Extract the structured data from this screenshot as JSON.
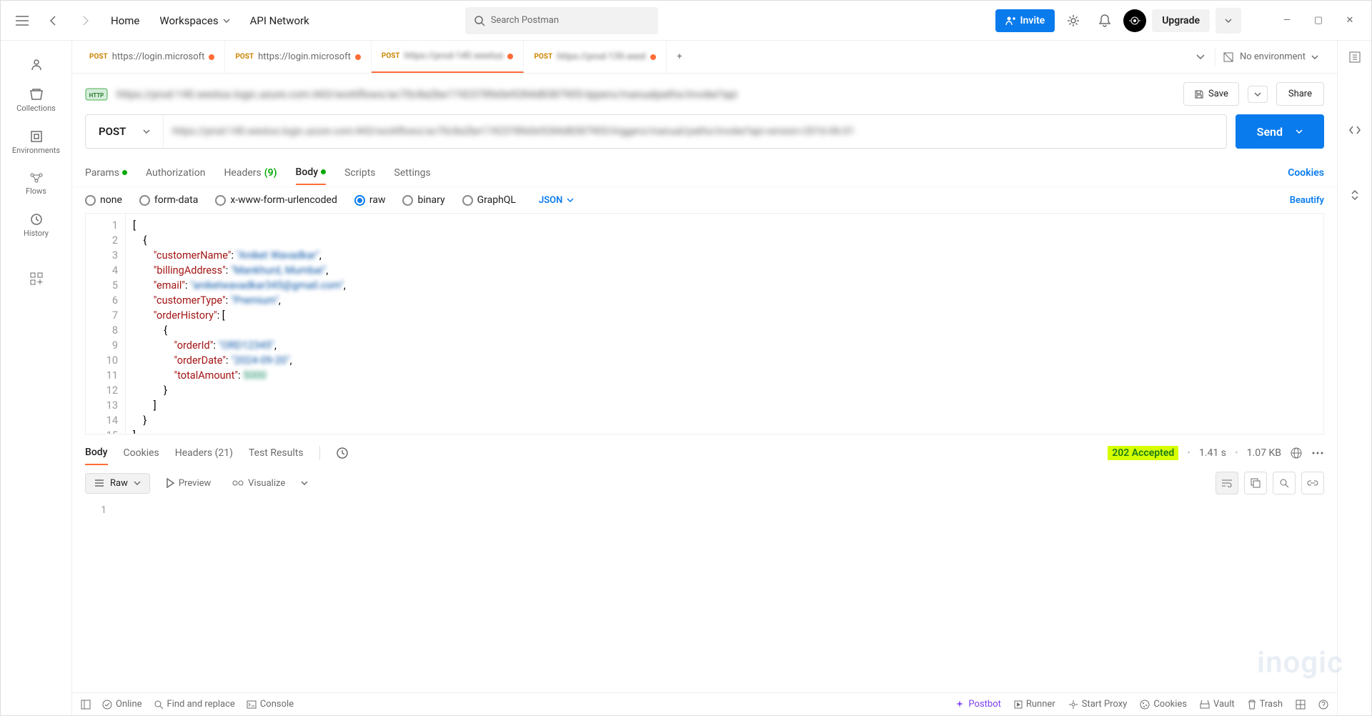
{
  "topbar": {
    "home": "Home",
    "workspaces": "Workspaces",
    "api_network": "API Network",
    "search_placeholder": "Search Postman",
    "invite": "Invite",
    "upgrade": "Upgrade"
  },
  "sidebar": {
    "items": [
      {
        "label": "Collections"
      },
      {
        "label": "Environments"
      },
      {
        "label": "Flows"
      },
      {
        "label": "History"
      }
    ]
  },
  "tabs": [
    {
      "method": "POST",
      "title": "https://login.microsoft",
      "active": false,
      "unsaved": true
    },
    {
      "method": "POST",
      "title": "https://login.microsoft",
      "active": false,
      "unsaved": true
    },
    {
      "method": "POST",
      "title": "https://prod-140.westus",
      "active": true,
      "unsaved": true,
      "blur": true
    },
    {
      "method": "POST",
      "title": "https://prod-139.west",
      "active": false,
      "unsaved": true,
      "blur": true
    }
  ],
  "environment": "No environment",
  "request": {
    "title": "https://prod-140.westus.logic.azure.com:443/workflows/ac70c8a2be1742378fe0e9284d8387905-tppers/manualpaths/invoke?api",
    "method": "POST",
    "url": "https://prod-140.westus.logic.azure.com:443/workflows/ac70c8a2be1742378fe0e9284d8387905/triggers/manual/paths/invoke?api-version=2016-06-01",
    "save": "Save",
    "share": "Share",
    "send": "Send"
  },
  "req_tabs": {
    "params": "Params",
    "auth": "Authorization",
    "headers": "Headers",
    "headers_count": "(9)",
    "body": "Body",
    "scripts": "Scripts",
    "settings": "Settings",
    "cookies": "Cookies"
  },
  "body_opts": {
    "none": "none",
    "form_data": "form-data",
    "xwww": "x-www-form-urlencoded",
    "raw": "raw",
    "binary": "binary",
    "graphql": "GraphQL",
    "json": "JSON",
    "beautify": "Beautify"
  },
  "editor": {
    "keys": {
      "customerName": "\"customerName\"",
      "billingAddress": "\"billingAddress\"",
      "email": "\"email\"",
      "customerType": "\"customerType\"",
      "orderHistory": "\"orderHistory\"",
      "orderId": "\"orderId\"",
      "orderDate": "\"orderDate\"",
      "totalAmount": "\"totalAmount\""
    },
    "values": {
      "customerName": "\"Aniket Wavadkar\"",
      "billingAddress": "\"Mankhurd, Mumbai\"",
      "email": "\"aniketwavadkar345@gmail.com\"",
      "customerType": "\"Premium\"",
      "orderId": "\"ORD12345\"",
      "orderDate": "\"2024-09-20\"",
      "totalAmount": "5000"
    }
  },
  "response": {
    "body": "Body",
    "cookies": "Cookies",
    "headers": "Headers",
    "headers_count": "(21)",
    "test_results": "Test Results",
    "status": "202 Accepted",
    "time": "1.41 s",
    "size": "1.07 KB",
    "raw": "Raw",
    "preview": "Preview",
    "visualize": "Visualize",
    "line1": "1"
  },
  "footer": {
    "online": "Online",
    "find": "Find and replace",
    "console": "Console",
    "postbot": "Postbot",
    "runner": "Runner",
    "start_proxy": "Start Proxy",
    "cookies": "Cookies",
    "vault": "Vault",
    "trash": "Trash"
  },
  "watermark": "inogic"
}
